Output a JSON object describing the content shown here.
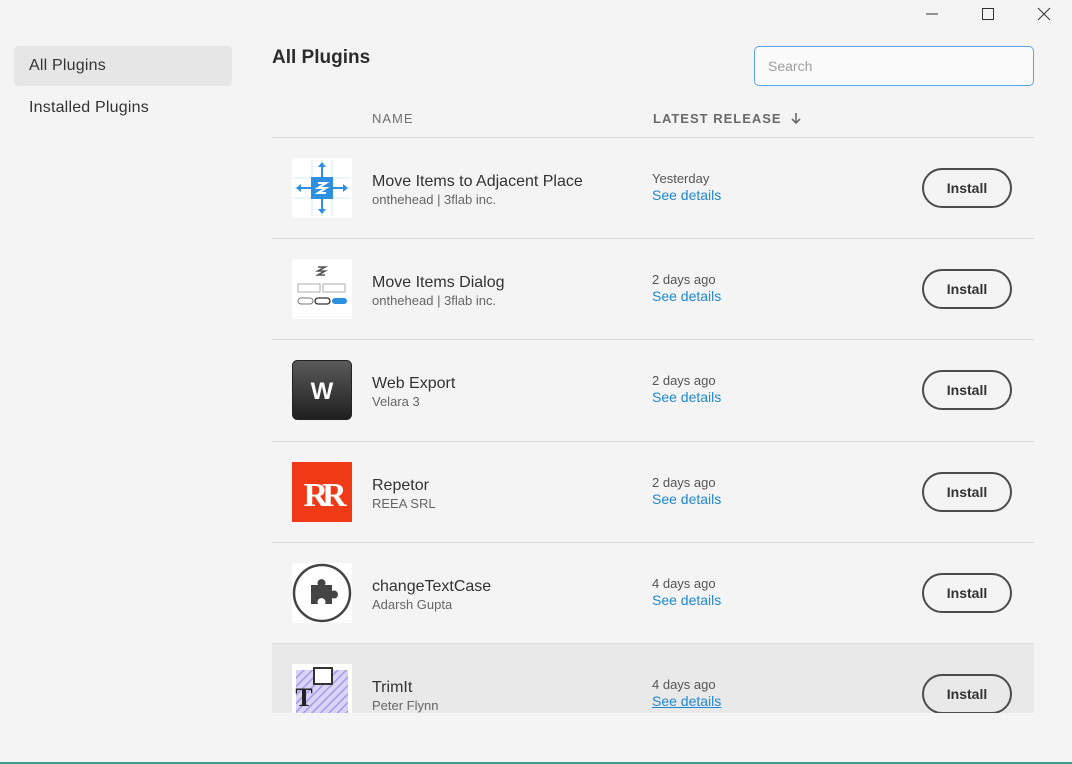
{
  "window": {
    "minimize_icon": "minimize-icon",
    "maximize_icon": "maximize-icon",
    "close_icon": "close-icon"
  },
  "sidebar": {
    "items": [
      {
        "label": "All Plugins",
        "active": true
      },
      {
        "label": "Installed Plugins",
        "active": false
      }
    ]
  },
  "main": {
    "title": "All Plugins",
    "search": {
      "placeholder": "Search",
      "value": ""
    },
    "columns": {
      "name": "NAME",
      "release": "LATEST RELEASE",
      "sort_icon": "arrow-down-icon"
    },
    "plugins": [
      {
        "name": "Move Items to Adjacent Place",
        "author": "onthehead | 3flab inc.",
        "date": "Yesterday",
        "details": "See details",
        "action": "Install",
        "icon": "move-items-icon"
      },
      {
        "name": "Move Items Dialog",
        "author": "onthehead | 3flab inc.",
        "date": "2 days ago",
        "details": "See details",
        "action": "Install",
        "icon": "move-dialog-icon"
      },
      {
        "name": "Web Export",
        "author": "Velara 3",
        "date": "2 days ago",
        "details": "See details",
        "action": "Install",
        "icon": "web-export-icon",
        "icon_letter": "W"
      },
      {
        "name": "Repetor",
        "author": "REEA SRL",
        "date": "2 days ago",
        "details": "See details",
        "action": "Install",
        "icon": "repetor-icon",
        "icon_letter": "RR"
      },
      {
        "name": "changeTextCase",
        "author": "Adarsh Gupta",
        "date": "4 days ago",
        "details": "See details",
        "action": "Install",
        "icon": "puzzle-icon"
      },
      {
        "name": "TrimIt",
        "author": "Peter Flynn",
        "date": "4 days ago",
        "details": "See details",
        "action": "Install",
        "icon": "trimit-icon",
        "icon_letter": "T"
      }
    ]
  },
  "colors": {
    "accent": "#1e88d2",
    "search_border": "#55a4e8",
    "repetor": "#f03a17"
  }
}
